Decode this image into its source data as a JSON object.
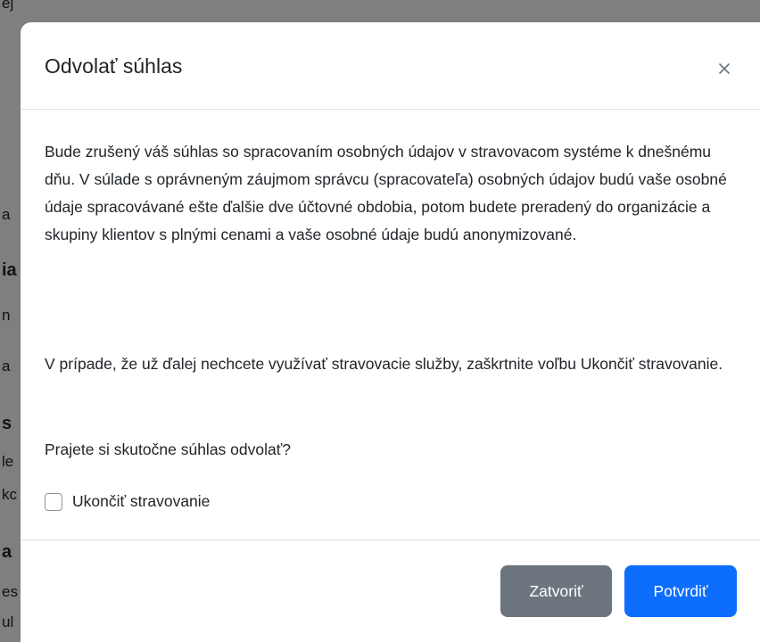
{
  "background": {
    "fragments": [
      "ej",
      "a",
      "ia",
      "n",
      "a",
      "s",
      "le",
      "kc",
      "a",
      "es",
      "ul"
    ]
  },
  "modal": {
    "title": "Odvolať súhlas",
    "close_label": "×",
    "body": {
      "paragraph_1": "Bude zrušený váš súhlas so spracovaním osobných údajov v stravovacom systéme k dnešnému dňu. V súlade s oprávneným záujmom správcu (spracovateľa) osobných údajov budú vaše osobné údaje spracovávané ešte ďalšie dve účtovné obdobia, potom budete preradený do organizácie a skupiny klientov s plnými cenami a vaše osobné údaje budú anonymizované.",
      "paragraph_2": "V prípade, že už ďalej nechcete využívať stravovacie služby, zaškrtnite voľbu Ukončiť stravovanie.",
      "question": "Prajete si skutočne súhlas odvolať?",
      "checkbox_label": "Ukončiť stravovanie",
      "checkbox_checked": false
    },
    "footer": {
      "close_button_label": "Zatvoriť",
      "confirm_button_label": "Potvrdiť"
    }
  },
  "colors": {
    "primary": "#0d6efd",
    "secondary": "#6c757d",
    "backdrop": "rgba(0,0,0,0.5)"
  }
}
